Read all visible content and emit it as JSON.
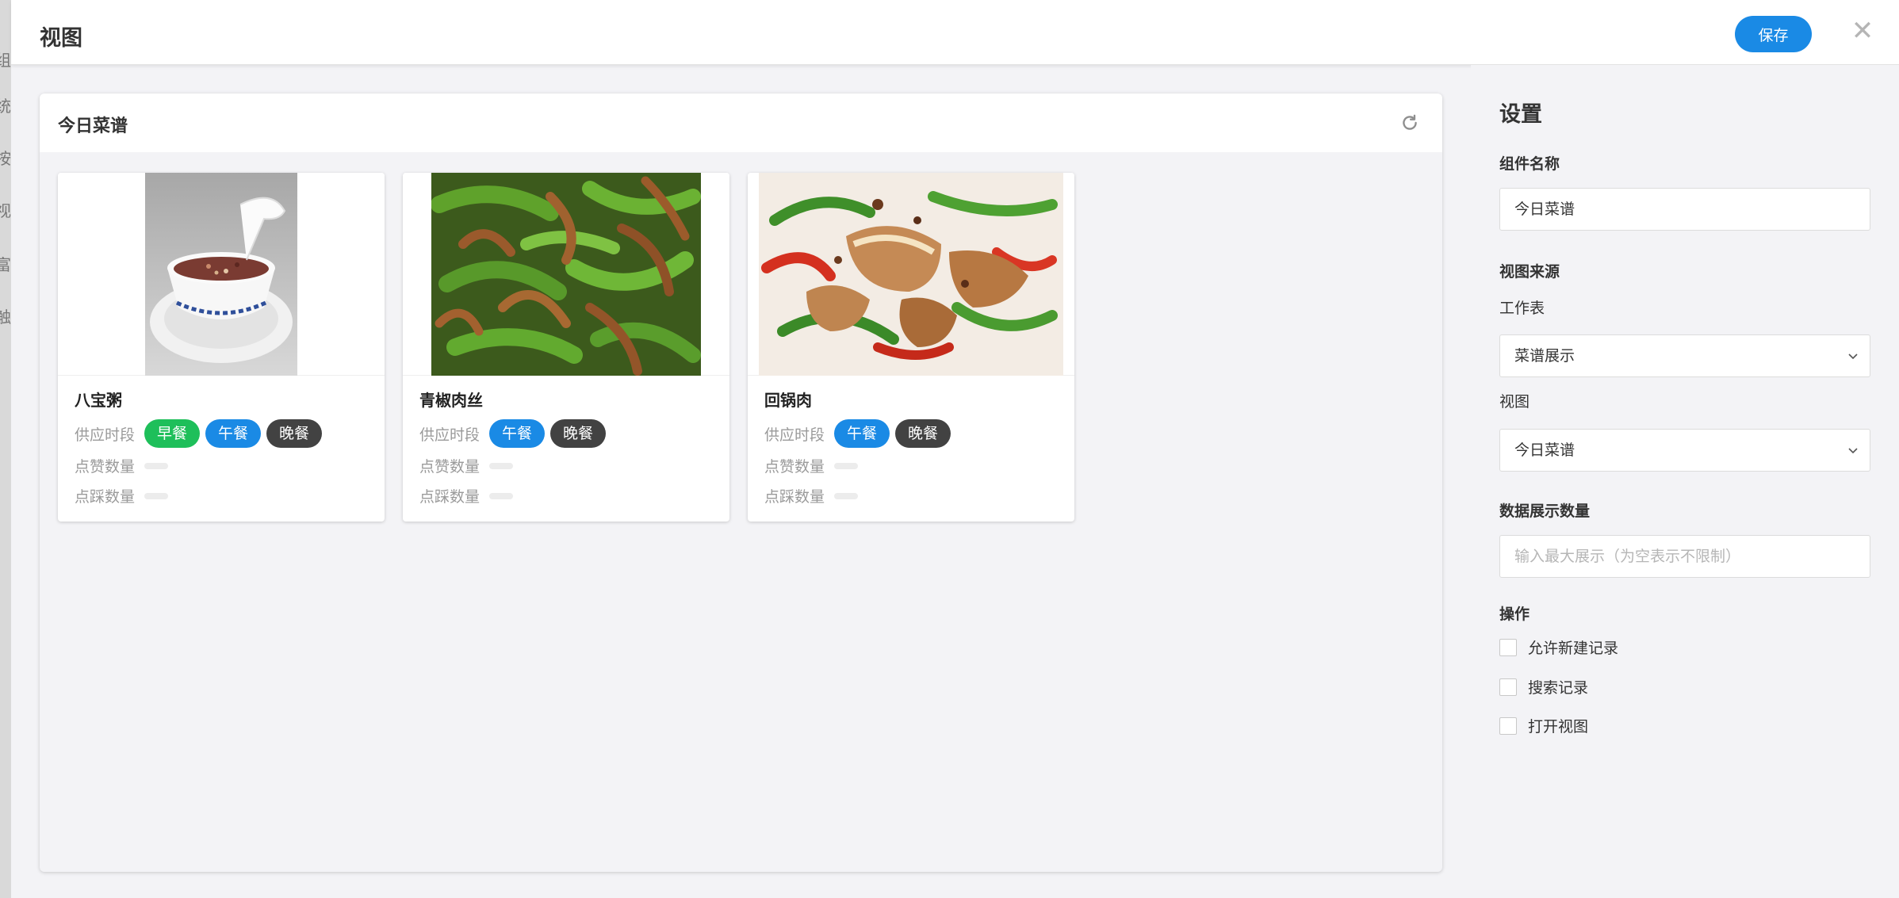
{
  "background_page": {
    "fragments": [
      "组",
      "统",
      "按",
      "视",
      "富",
      "触"
    ]
  },
  "modal": {
    "title": "视图",
    "save_label": "保存",
    "close_icon": "close-icon"
  },
  "panel": {
    "title": "今日菜谱",
    "refresh_icon": "refresh-icon"
  },
  "cards": [
    {
      "name": "八宝粥",
      "time_label": "供应时段",
      "tags": [
        {
          "text": "早餐",
          "color": "#1ebf5a"
        },
        {
          "text": "午餐",
          "color": "#1a8ae5"
        },
        {
          "text": "晚餐",
          "color": "#424242"
        }
      ],
      "likes_label": "点赞数量",
      "dislikes_label": "点踩数量"
    },
    {
      "name": "青椒肉丝",
      "time_label": "供应时段",
      "tags": [
        {
          "text": "午餐",
          "color": "#1a8ae5"
        },
        {
          "text": "晚餐",
          "color": "#424242"
        }
      ],
      "likes_label": "点赞数量",
      "dislikes_label": "点踩数量"
    },
    {
      "name": "回锅肉",
      "time_label": "供应时段",
      "tags": [
        {
          "text": "午餐",
          "color": "#1a8ae5"
        },
        {
          "text": "晚餐",
          "color": "#424242"
        }
      ],
      "likes_label": "点赞数量",
      "dislikes_label": "点踩数量"
    }
  ],
  "settings": {
    "title": "设置",
    "component_name_label": "组件名称",
    "component_name_value": "今日菜谱",
    "view_source_label": "视图来源",
    "worksheet_label": "工作表",
    "worksheet_value": "菜谱展示",
    "view_label": "视图",
    "view_value": "今日菜谱",
    "display_count_label": "数据展示数量",
    "display_count_placeholder": "输入最大展示（为空表示不限制）",
    "actions_label": "操作",
    "actions": [
      "允许新建记录",
      "搜索记录",
      "打开视图"
    ]
  },
  "colors": {
    "accent": "#1a8ae5",
    "breakfast": "#1ebf5a",
    "dinner": "#424242"
  }
}
